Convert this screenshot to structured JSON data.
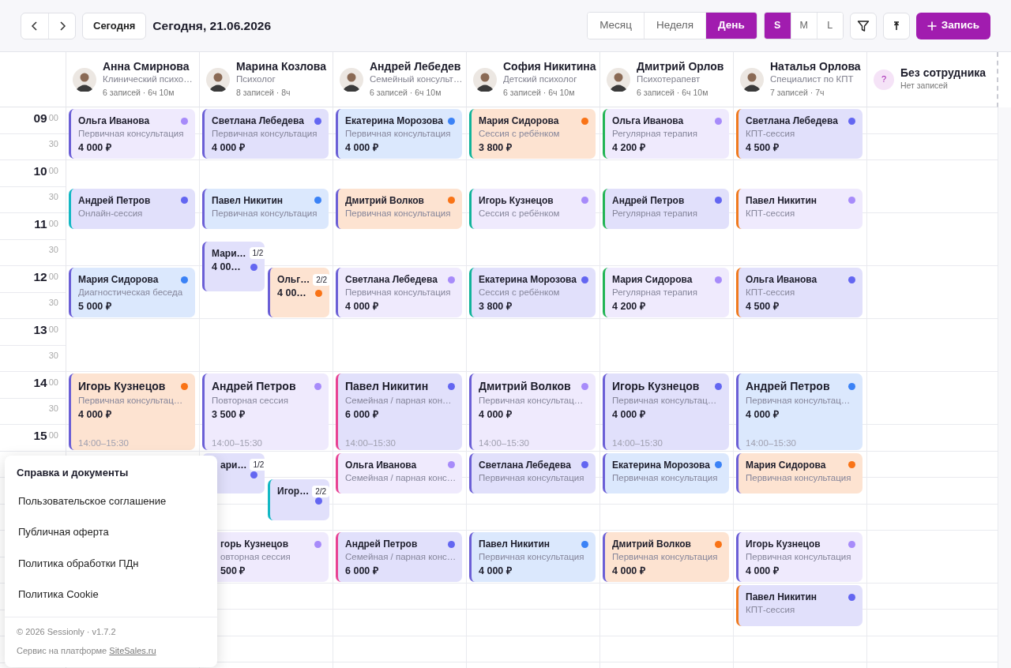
{
  "toolbar": {
    "today_button": "Сегодня",
    "date_title": "Сегодня, 21.06.2026",
    "views": [
      {
        "label": "Месяц",
        "selected": false
      },
      {
        "label": "Неделя",
        "selected": false
      },
      {
        "label": "День",
        "selected": true
      }
    ],
    "sizes": [
      {
        "label": "S",
        "selected": true
      },
      {
        "label": "M",
        "selected": false
      },
      {
        "label": "L",
        "selected": false
      }
    ],
    "new_button": "Запись"
  },
  "time_labels": [
    {
      "hour": "09",
      "minute": "00"
    },
    {
      "minute": "30"
    },
    {
      "hour": "10",
      "minute": "00"
    },
    {
      "minute": "30"
    },
    {
      "hour": "11",
      "minute": "00"
    },
    {
      "minute": "30"
    },
    {
      "hour": "12",
      "minute": "00"
    },
    {
      "minute": "30"
    },
    {
      "hour": "13",
      "minute": "00"
    },
    {
      "minute": "30"
    },
    {
      "hour": "14",
      "minute": "00"
    },
    {
      "minute": "30"
    },
    {
      "hour": "15",
      "minute": "00"
    }
  ],
  "staff": [
    {
      "name": "Анна Смирнова",
      "role": "Клинический психо…",
      "stats": "6 записей · 6ч 10м",
      "events": [
        {
          "name": "Ольга Иванова",
          "service": "Первичная консультация",
          "price": "4 000 ₽",
          "color": "#a78bfa",
          "bar": {
            "color": "#6b5fd6"
          }
        },
        {
          "name": "Андрей Петров",
          "service": "Онлайн-сессия",
          "color": "#6366f1",
          "bar": {
            "color": "#14b8c4"
          }
        },
        {
          "name": "Мария Сидорова",
          "service": "Диагностическая беседа",
          "price": "5 000 ₽",
          "color": "#3b82f6",
          "bar": {
            "color": "#6b5fd6"
          }
        },
        {
          "name": "Игорь Кузнецов",
          "service": "Первичная консультац…",
          "price": "4 000 ₽",
          "time": "14:00–15:30",
          "color": "#f97316",
          "bar": {
            "color": "#6b5fd6"
          }
        }
      ]
    },
    {
      "name": "Марина Козлова",
      "role": "Психолог",
      "stats": "8 записей · 8ч",
      "events": [
        {
          "name": "Светлана Лебедева",
          "service": "Первичная консультация",
          "price": "4 000 ₽",
          "color": "#6366f1",
          "bar": {
            "color": "#6b5fd6"
          }
        },
        {
          "name": "Павел Никитин",
          "service": "Первичная консультация",
          "color": "#3b82f6",
          "bar": {
            "color": "#6b5fd6"
          }
        },
        {
          "name": "Мари…",
          "price": "4 00…",
          "badge": "1/2",
          "color": "#6366f1",
          "bar": {
            "color": "#6b5fd6"
          }
        },
        {
          "name": "Ольг…",
          "price": "4 00…",
          "badge": "2/2",
          "color": "#f97316",
          "bar": {
            "color": "#6b5fd6"
          }
        },
        {
          "name": "Андрей Петров",
          "service": "Повторная сессия",
          "price": "3 500 ₽",
          "time": "14:00–15:30",
          "color": "#a78bfa",
          "bar": {
            "color": "#6b5fd6"
          }
        },
        {
          "name": "ари…",
          "badge": "1/2",
          "partly_hidden": true,
          "color": "#6366f1"
        },
        {
          "name": "Игор…",
          "badge": "2/2",
          "color": "#6366f1",
          "bar": {
            "color": "#14b8c4"
          }
        },
        {
          "name": "горь Кузнецов",
          "service": "овторная сессия",
          "price": "500 ₽",
          "partly_hidden": true,
          "color": "#a78bfa"
        }
      ]
    },
    {
      "name": "Андрей Лебедев",
      "role": "Семейный консульт…",
      "stats": "6 записей · 6ч 10м",
      "events": [
        {
          "name": "Екатерина Морозова",
          "service": "Первичная консультация",
          "price": "4 000 ₽",
          "color": "#3b82f6",
          "bar": {
            "color": "#6b5fd6"
          }
        },
        {
          "name": "Дмитрий Волков",
          "service": "Первичная консультация",
          "color": "#f97316",
          "bar": {
            "color": "#6b5fd6"
          }
        },
        {
          "name": "Светлана Лебедева",
          "service": "Первичная консультация",
          "price": "4 000 ₽",
          "color": "#a78bfa",
          "bar": {
            "color": "#6b5fd6"
          }
        },
        {
          "name": "Павел Никитин",
          "service": "Семейная / парная кон…",
          "price": "6 000 ₽",
          "time": "14:00–15:30",
          "color": "#6366f1",
          "bar": {
            "color": "#e84393"
          }
        },
        {
          "name": "Ольга Иванова",
          "service": "Семейная / парная конс…",
          "color": "#a78bfa",
          "bar": {
            "color": "#e84393"
          }
        },
        {
          "name": "Андрей Петров",
          "service": "Семейная / парная конс…",
          "price": "6 000 ₽",
          "color": "#6366f1",
          "bar": {
            "color": "#e84393"
          }
        }
      ]
    },
    {
      "name": "София Никитина",
      "role": "Детский психолог",
      "stats": "6 записей · 6ч 10м",
      "events": [
        {
          "name": "Мария Сидорова",
          "service": "Сессия с ребёнком",
          "price": "3 800 ₽",
          "color": "#f97316",
          "bar": {
            "color": "#10b39a"
          }
        },
        {
          "name": "Игорь Кузнецов",
          "service": "Сессия с ребёнком",
          "color": "#a78bfa",
          "bar": {
            "color": "#10b39a"
          }
        },
        {
          "name": "Екатерина Морозова",
          "service": "Сессия с ребёнком",
          "price": "3 800 ₽",
          "color": "#6366f1",
          "bar": {
            "color": "#10b39a"
          }
        },
        {
          "name": "Дмитрий Волков",
          "service": "Первичная консультац…",
          "price": "4 000 ₽",
          "time": "14:00–15:30",
          "color": "#a78bfa",
          "bar": {
            "color": "#6b5fd6"
          }
        },
        {
          "name": "Светлана Лебедева",
          "service": "Первичная консультация",
          "color": "#6366f1",
          "bar": {
            "color": "#6b5fd6"
          }
        },
        {
          "name": "Павел Никитин",
          "service": "Первичная консультация",
          "price": "4 000 ₽",
          "color": "#3b82f6",
          "bar": {
            "color": "#6b5fd6"
          }
        }
      ]
    },
    {
      "name": "Дмитрий Орлов",
      "role": "Психотерапевт",
      "stats": "6 записей · 6ч 10м",
      "events": [
        {
          "name": "Ольга Иванова",
          "service": "Регулярная терапия",
          "price": "4 200 ₽",
          "color": "#a78bfa",
          "bar": {
            "color": "#22b455"
          }
        },
        {
          "name": "Андрей Петров",
          "service": "Регулярная терапия",
          "color": "#6366f1",
          "bar": {
            "color": "#22b455"
          }
        },
        {
          "name": "Мария Сидорова",
          "service": "Регулярная терапия",
          "price": "4 200 ₽",
          "color": "#a78bfa",
          "bar": {
            "color": "#22b455"
          }
        },
        {
          "name": "Игорь Кузнецов",
          "service": "Первичная консультац…",
          "price": "4 000 ₽",
          "time": "14:00–15:30",
          "color": "#6366f1",
          "bar": {
            "color": "#6b5fd6"
          }
        },
        {
          "name": "Екатерина Морозова",
          "service": "Первичная консультация",
          "color": "#3b82f6",
          "bar": {
            "color": "#6b5fd6"
          }
        },
        {
          "name": "Дмитрий Волков",
          "service": "Первичная консультация",
          "price": "4 000 ₽",
          "color": "#f97316",
          "bar": {
            "color": "#6b5fd6"
          }
        }
      ]
    },
    {
      "name": "Наталья Орлова",
      "role": "Специалист по КПТ",
      "stats": "7 записей · 7ч",
      "events": [
        {
          "name": "Светлана Лебедева",
          "service": "КПТ-сессия",
          "price": "4 500 ₽",
          "color": "#6366f1",
          "bar": {
            "color": "#f07a1e"
          }
        },
        {
          "name": "Павел Никитин",
          "service": "КПТ-сессия",
          "color": "#a78bfa",
          "bar": {
            "color": "#f07a1e"
          }
        },
        {
          "name": "Ольга Иванова",
          "service": "КПТ-сессия",
          "price": "4 500 ₽",
          "color": "#6366f1",
          "bar": {
            "color": "#f07a1e"
          }
        },
        {
          "name": "Андрей Петров",
          "service": "Первичная консультац…",
          "price": "4 000 ₽",
          "time": "14:00–15:30",
          "color": "#3b82f6",
          "bar": {
            "color": "#6b5fd6"
          }
        },
        {
          "name": "Мария Сидорова",
          "service": "Первичная консультация",
          "color": "#f97316",
          "bar": {
            "color": "#6b5fd6"
          }
        },
        {
          "name": "Игорь Кузнецов",
          "service": "Первичная консультация",
          "price": "4 000 ₽",
          "color": "#a78bfa",
          "bar": {
            "color": "#6b5fd6"
          }
        },
        {
          "name": "Павел Никитин",
          "service": "КПТ-сессия",
          "color": "#6366f1",
          "bar": {
            "color": "#f07a1e"
          }
        }
      ]
    }
  ],
  "unassigned": {
    "mark": "?",
    "name": "Без сотрудника",
    "stats": "Нет записей"
  },
  "help_menu": {
    "title": "Справка и документы",
    "links": [
      "Пользовательское соглашение",
      "Публичная оферта",
      "Политика обработки ПДн",
      "Политика Cookie"
    ],
    "copyright": "© 2026 Sessionly · v1.7.2",
    "platform_text": "Сервис на платформе ",
    "platform_link": "SiteSales.ru"
  }
}
